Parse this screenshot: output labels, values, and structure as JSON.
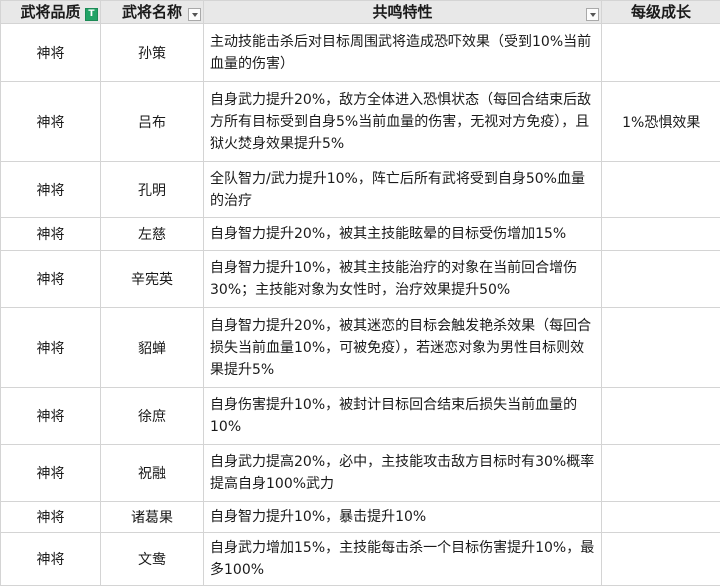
{
  "columns": [
    {
      "label": "武将品质",
      "filter": "active"
    },
    {
      "label": "武将名称",
      "filter": "dropdown"
    },
    {
      "label": "共鸣特性",
      "filter": "dropdown"
    },
    {
      "label": "每级成长",
      "filter": ""
    }
  ],
  "rows": [
    {
      "quality": "神将",
      "name": "孙策",
      "feature": "主动技能击杀后对目标周围武将造成恐吓效果（受到10%当前血量的伤害）",
      "growth": ""
    },
    {
      "quality": "神将",
      "name": "吕布",
      "feature": "自身武力提升20%，敌方全体进入恐惧状态（每回合结束后敌方所有目标受到自身5%当前血量的伤害，无视对方免疫），且狱火焚身效果提升5%",
      "growth": "1%恐惧效果"
    },
    {
      "quality": "神将",
      "name": "孔明",
      "feature": "全队智力/武力提升10%，阵亡后所有武将受到自身50%血量的治疗",
      "growth": ""
    },
    {
      "quality": "神将",
      "name": "左慈",
      "feature": "自身智力提升20%，被其主技能眩晕的目标受伤增加15%",
      "growth": ""
    },
    {
      "quality": "神将",
      "name": "辛宪英",
      "feature": "自身智力提升10%，被其主技能治疗的对象在当前回合增伤30%；主技能对象为女性时，治疗效果提升50%",
      "growth": ""
    },
    {
      "quality": "神将",
      "name": "貂蝉",
      "feature": "自身智力提升20%，被其迷恋的目标会触发艳杀效果（每回合损失当前血量10%，可被免疫），若迷恋对象为男性目标则效果提升5%",
      "growth": ""
    },
    {
      "quality": "神将",
      "name": "徐庶",
      "feature": "自身伤害提升10%，被封计目标回合结束后损失当前血量的10%",
      "growth": ""
    },
    {
      "quality": "神将",
      "name": "祝融",
      "feature": "自身武力提高20%，必中，主技能攻击敌方目标时有30%概率提高自身100%武力",
      "growth": ""
    },
    {
      "quality": "神将",
      "name": "诸葛果",
      "feature": "自身智力提升10%，暴击提升10%",
      "growth": ""
    },
    {
      "quality": "神将",
      "name": "文鸯",
      "feature": "自身武力增加15%，主技能每击杀一个目标伤害提升10%，最多100%",
      "growth": ""
    }
  ]
}
